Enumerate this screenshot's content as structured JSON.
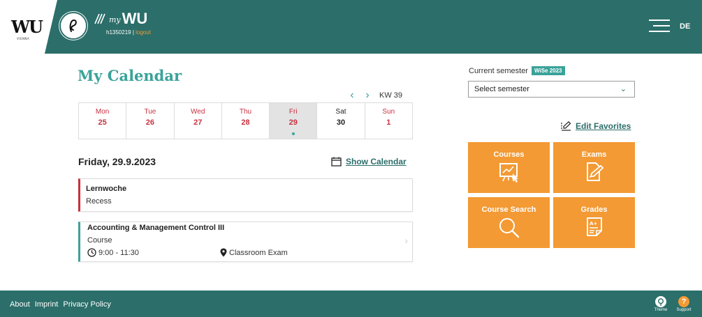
{
  "header": {
    "logo_text": "WU",
    "logo_sub": "VIENNA",
    "app_name_prefix": "my",
    "app_name": "WU",
    "user_id": "h1350219",
    "separator": " | ",
    "logout": "logout",
    "lang": "DE",
    "colors": {
      "bar": "#2b6e6a",
      "accent": "#f39a34"
    }
  },
  "calendar": {
    "title": "My Calendar",
    "prev_icon": "chevron-left-icon",
    "next_icon": "chevron-right-icon",
    "prev_glyph": "‹",
    "next_glyph": "›",
    "week_label": "KW 39",
    "days": [
      {
        "name": "Mon",
        "num": "25"
      },
      {
        "name": "Tue",
        "num": "26"
      },
      {
        "name": "Wed",
        "num": "27"
      },
      {
        "name": "Thu",
        "num": "28"
      },
      {
        "name": "Fri",
        "num": "29"
      },
      {
        "name": "Sat",
        "num": "30"
      },
      {
        "name": "Sun",
        "num": "1"
      }
    ],
    "selected_day": "Fri"
  },
  "agenda": {
    "date_heading": "Friday, 29.9.2023",
    "show_calendar": "Show Calendar",
    "events": [
      {
        "title": "Lernwoche",
        "type": "Recess"
      },
      {
        "title": "Accounting & Management Control III",
        "type": "Course",
        "time": "9:00 - 11:30",
        "location": "Classroom Exam"
      }
    ],
    "chevron": "›"
  },
  "semester": {
    "label": "Current semester",
    "badge": "WiSe 2023",
    "select_placeholder": "Select semester",
    "chevron": "⌄"
  },
  "favorites": {
    "edit_label": "Edit Favorites",
    "tiles": [
      {
        "label": "Courses",
        "icon": "presentation-board-icon"
      },
      {
        "label": "Exams",
        "icon": "document-edit-icon"
      },
      {
        "label": "Course Search",
        "icon": "magnifier-icon"
      },
      {
        "label": "Grades",
        "icon": "grade-sheet-icon"
      }
    ]
  },
  "footer": {
    "links": [
      "About",
      "Imprint",
      "Privacy Policy"
    ],
    "theme_label": "Theme",
    "support_label": "Support",
    "support_glyph": "?"
  }
}
